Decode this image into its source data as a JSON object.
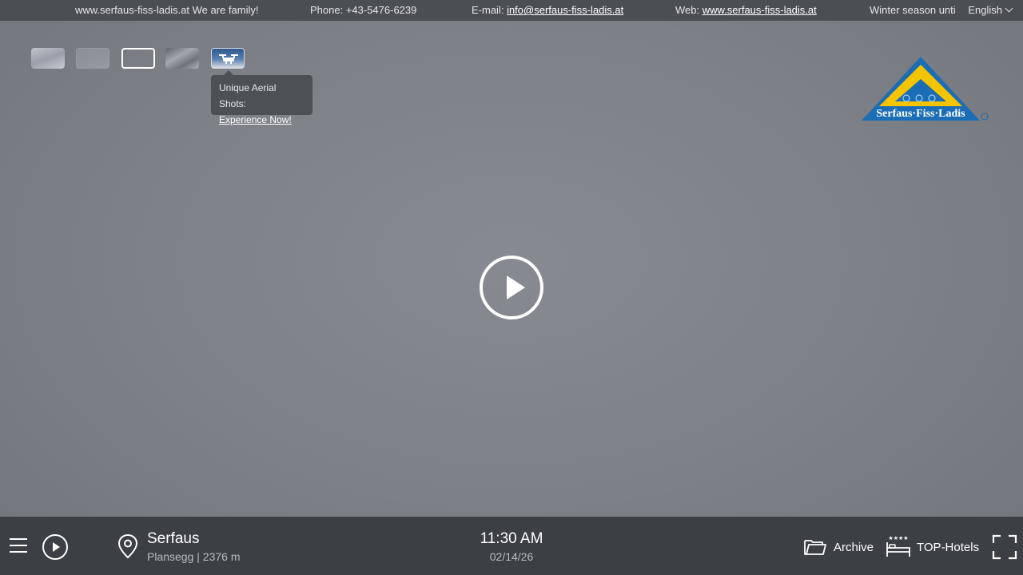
{
  "topbar": {
    "slogan": "www.serfaus-fiss-ladis.at We are family!",
    "phone_label": "Phone: +43-5476-6239",
    "email_label": "E-mail: ",
    "email": "info@serfaus-fiss-ladis.at",
    "web_label": "Web: ",
    "web": "www.serfaus-fiss-ladis.at",
    "season": "Winter season unti",
    "language": "English"
  },
  "thumbnails": [
    {
      "name": "webcam-thumb-1"
    },
    {
      "name": "webcam-thumb-2"
    },
    {
      "name": "webcam-thumb-3",
      "active": true
    },
    {
      "name": "webcam-thumb-4"
    },
    {
      "name": "aerial-drone-thumb",
      "icon": "drone-icon"
    }
  ],
  "tooltip": {
    "title": "Unique Aerial Shots:",
    "link": "Experience Now!"
  },
  "logo": {
    "text": "Serfaus·Fiss·Ladis",
    "colors": {
      "blue": "#1b6db5",
      "yellow": "#f5c400",
      "white": "#ffffff"
    }
  },
  "location": {
    "name": "Serfaus",
    "detail": "Plansegg | 2376 m"
  },
  "datetime": {
    "time": "11:30 AM",
    "date": "02/14/26"
  },
  "actions": {
    "archive": "Archive",
    "hotels": "TOP-Hotels"
  }
}
